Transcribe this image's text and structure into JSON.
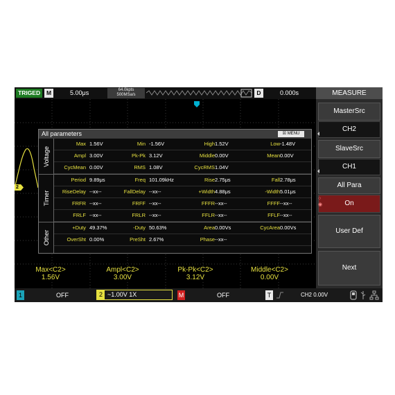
{
  "top": {
    "trig_status": "TRIGED",
    "mode_label": "M",
    "timebase": "5.00μs",
    "sample_pts": "64.0kpts",
    "sample_rate": "500MSa/s",
    "delay_label": "D",
    "delay_value": "0.000s"
  },
  "menu": {
    "title": "MEASURE",
    "items": [
      {
        "label": "MasterSrc",
        "value": "CH2"
      },
      {
        "label": "SlaveSrc",
        "value": "CH1"
      },
      {
        "label": "All Para",
        "value": "On"
      },
      {
        "label": "User Def"
      },
      {
        "label": "Next"
      }
    ]
  },
  "dialog": {
    "title": "All parameters",
    "menu_label": "MENU",
    "sections": {
      "voltage": "Voltage",
      "timer": "Timer",
      "other": "Other"
    },
    "rows": [
      [
        [
          "Max",
          "1.56V"
        ],
        [
          "Min",
          "-1.56V"
        ],
        [
          "High",
          "1.52V"
        ],
        [
          "Low",
          "-1.48V"
        ]
      ],
      [
        [
          "Ampl",
          "3.00V"
        ],
        [
          "Pk-Pk",
          "3.12V"
        ],
        [
          "Middle",
          "0.00V"
        ],
        [
          "Mean",
          "0.00V"
        ]
      ],
      [
        [
          "CycMean",
          "0.00V"
        ],
        [
          "RMS",
          "1.08V"
        ],
        [
          "CycRMS",
          "1.04V"
        ],
        [
          "",
          ""
        ]
      ],
      [
        [
          "Period",
          "9.89μs"
        ],
        [
          "Freq",
          "101.09kHz"
        ],
        [
          "Rise",
          "2.75μs"
        ],
        [
          "Fall",
          "2.78μs"
        ]
      ],
      [
        [
          "RiseDelay",
          "--xx--"
        ],
        [
          "FallDelay",
          "--xx--"
        ],
        [
          "+Width",
          "4.88μs"
        ],
        [
          "-Width",
          "5.01μs"
        ]
      ],
      [
        [
          "FRFR",
          "--xx--"
        ],
        [
          "FRFF",
          "--xx--"
        ],
        [
          "FFFR",
          "--xx--"
        ],
        [
          "FFFF",
          "--xx--"
        ]
      ],
      [
        [
          "FRLF",
          "--xx--"
        ],
        [
          "FRLR",
          "--xx--"
        ],
        [
          "FFLR",
          "--xx--"
        ],
        [
          "FFLF",
          "--xx--"
        ]
      ],
      [
        [
          "+Duty",
          "49.37%"
        ],
        [
          "-Duty",
          "50.63%"
        ],
        [
          "Area",
          "0.00Vs"
        ],
        [
          "CycArea",
          "0.00Vs"
        ]
      ],
      [
        [
          "OverSht",
          "0.00%"
        ],
        [
          "PreSht",
          "2.67%"
        ],
        [
          "Phase",
          "--xx--"
        ],
        [
          "",
          ""
        ]
      ]
    ]
  },
  "readouts": [
    {
      "name": "Max<C2>",
      "value": "1.56V"
    },
    {
      "name": "Ampl<C2>",
      "value": "3.00V"
    },
    {
      "name": "Pk-Pk<C2>",
      "value": "3.12V"
    },
    {
      "name": "Middle<C2>",
      "value": "0.00V"
    }
  ],
  "bottom": {
    "ch1_num": "1",
    "ch1_state": "OFF",
    "ch2_num": "2",
    "ch2_setting": "~1.00V  1X",
    "math_label": "M",
    "math_state": "OFF",
    "trig_label": "T",
    "trig_info": "CH2  0.00V"
  },
  "marker": {
    "ch2": "2"
  },
  "colors": {
    "ch2": "#e6e040",
    "trig": "#00b0d0",
    "ch1": "#1aa3b8",
    "math": "#d02020",
    "triged": "#1d7b22",
    "on": "#7a1a1a"
  }
}
